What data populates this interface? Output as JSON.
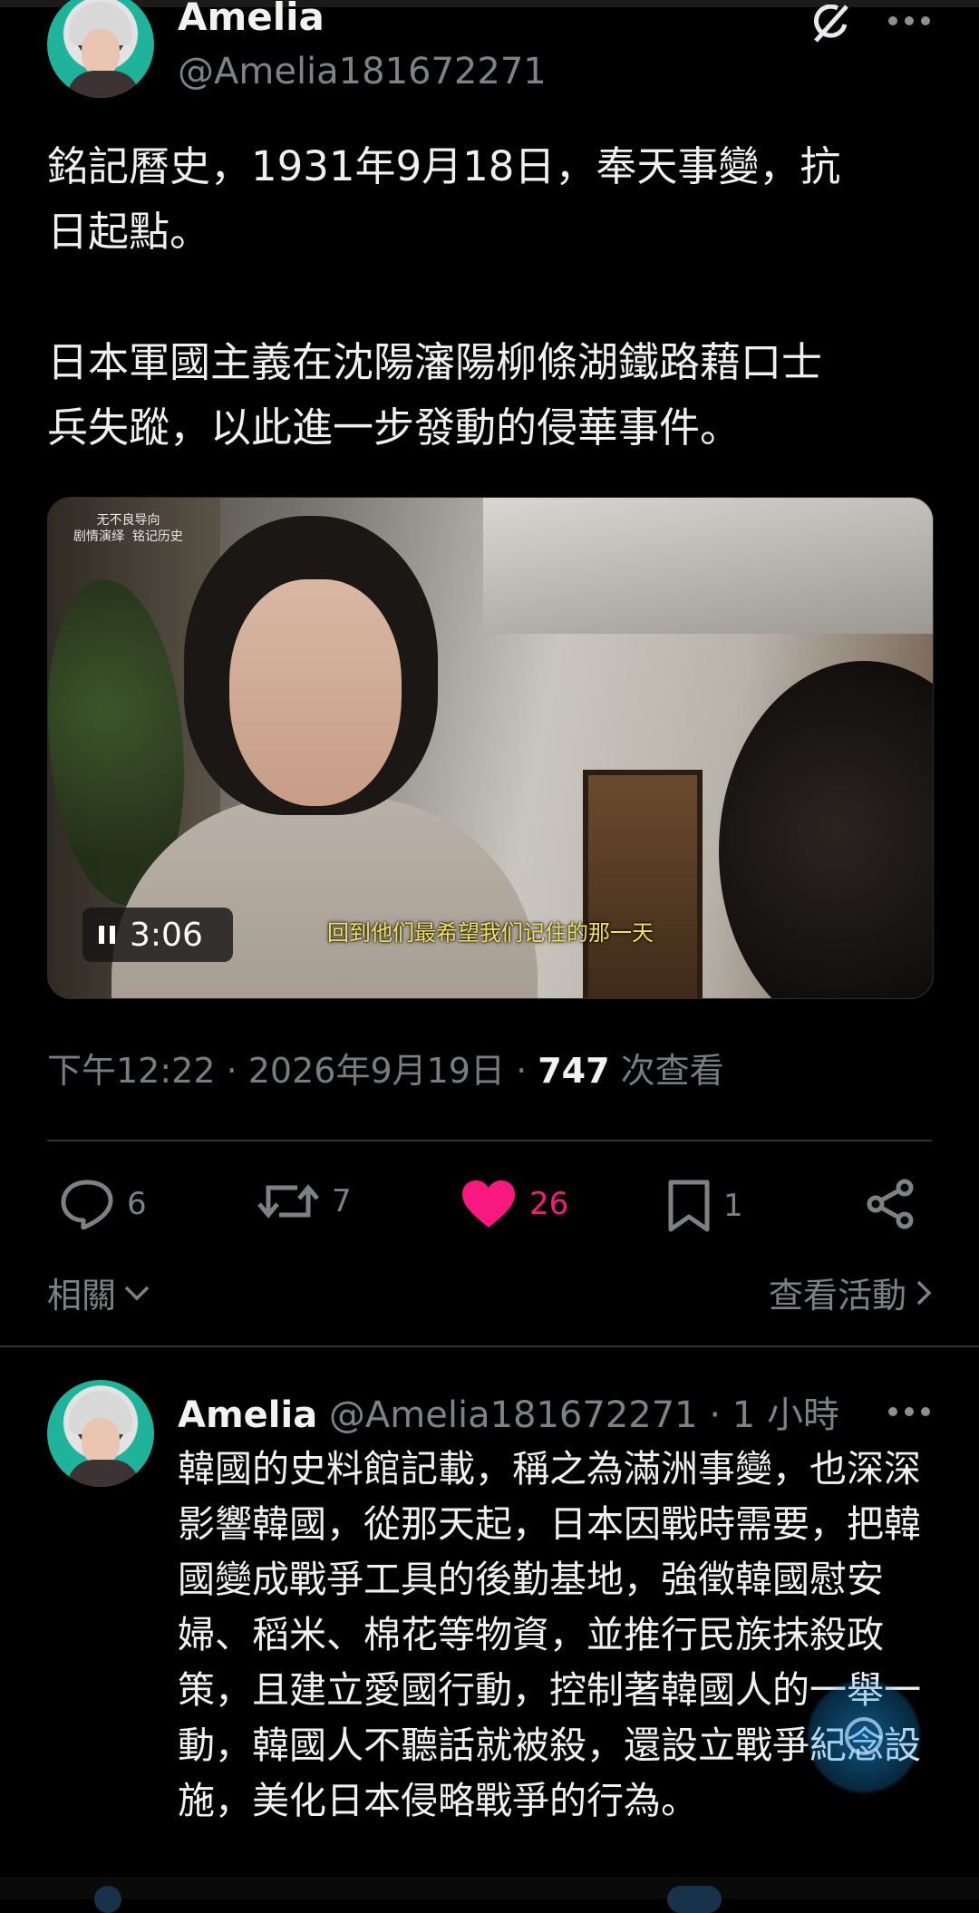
{
  "post": {
    "author_name": "Amelia",
    "author_handle": "@Amelia181672271",
    "text": "銘記曆史，1931年9月18日，奉天事變，抗\n日起點。\n\n日本軍國主義在沈陽瀋陽柳條湖鐵路藉口士\n兵失蹤，以此進一步發動的侵華事件。",
    "video": {
      "watermark": "无不良导向\n剧情演绎  铭记历史",
      "subtitle": "回到他们最希望我们记住的那一天",
      "duration": "3:06"
    },
    "time_date": "下午12:22 · 2026年9月19日 · ",
    "views_count": "747",
    "views_label": " 次查看",
    "actions": {
      "replies": "6",
      "reposts": "7",
      "likes": "26",
      "bookmarks": "1"
    },
    "related_label": "相關",
    "activity_label": "查看活動"
  },
  "reply": {
    "author_name": "Amelia",
    "author_handle": "@Amelia181672271",
    "time": "· 1 小時",
    "text": "韓國的史料館記載，稱之為滿洲事變，也深深影響韓國，從那天起，日本因戰時需要，把韓國變成戰爭工具的後勤基地，強徵韓國慰安婦、稻米、棉花等物資，並推行民族抹殺政策，且建立愛國行動，控制著韓國人的一舉一動，韓國人不聽話就被殺，還設立戰爭紀念設施，美化日本侵略戰爭的行為。"
  },
  "colors": {
    "background": "#000000",
    "text": "#e7e9ea",
    "muted": "#7b8185",
    "like": "#f91880",
    "accent": "#1d9bf0"
  },
  "icons": [
    "grok-icon",
    "more-icon",
    "reply-icon",
    "repost-icon",
    "heart-icon",
    "bookmark-icon",
    "share-icon",
    "chevron-down-icon",
    "chevron-right-icon",
    "pause-icon"
  ]
}
